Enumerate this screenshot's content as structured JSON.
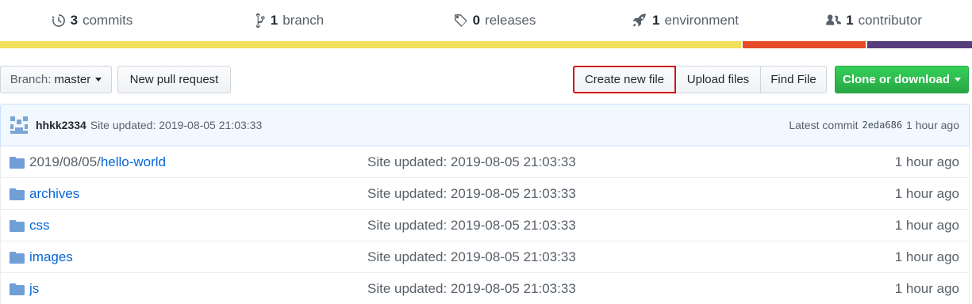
{
  "summary": {
    "commits": {
      "count": "3",
      "label": "commits",
      "icon": "history-icon"
    },
    "branch": {
      "count": "1",
      "label": "branch",
      "icon": "git-branch-icon"
    },
    "releases": {
      "count": "0",
      "label": "releases",
      "icon": "tag-icon"
    },
    "environment": {
      "count": "1",
      "label": "environment",
      "icon": "rocket-icon"
    },
    "contributor": {
      "count": "1",
      "label": "contributor",
      "icon": "people-icon"
    }
  },
  "language_bar": [
    {
      "color": "#f1e05a",
      "fraction": 0.765
    },
    {
      "color": "#e34c26",
      "fraction": 0.127
    },
    {
      "color": "#563d7c",
      "fraction": 0.108
    }
  ],
  "toolbar": {
    "branch_prefix": "Branch:",
    "branch_name": "master",
    "new_pr": "New pull request",
    "create_file": "Create new file",
    "upload_files": "Upload files",
    "find_file": "Find File",
    "clone": "Clone or download"
  },
  "commit": {
    "author": "hhkk2334",
    "message": "Site updated: 2019-08-05 21:03:33",
    "latest_label": "Latest commit",
    "sha": "2eda686",
    "age": "1 hour ago"
  },
  "files": [
    {
      "prefix": "2019/08/05/",
      "name": "hello-world",
      "message": "Site updated: 2019-08-05 21:03:33",
      "age": "1 hour ago"
    },
    {
      "prefix": "",
      "name": "archives",
      "message": "Site updated: 2019-08-05 21:03:33",
      "age": "1 hour ago"
    },
    {
      "prefix": "",
      "name": "css",
      "message": "Site updated: 2019-08-05 21:03:33",
      "age": "1 hour ago"
    },
    {
      "prefix": "",
      "name": "images",
      "message": "Site updated: 2019-08-05 21:03:33",
      "age": "1 hour ago"
    },
    {
      "prefix": "",
      "name": "js",
      "message": "Site updated: 2019-08-05 21:03:33",
      "age": "1 hour ago"
    }
  ],
  "colors": {
    "link": "#0366d6",
    "green": "#28a745",
    "highlight": "#d0121b"
  }
}
